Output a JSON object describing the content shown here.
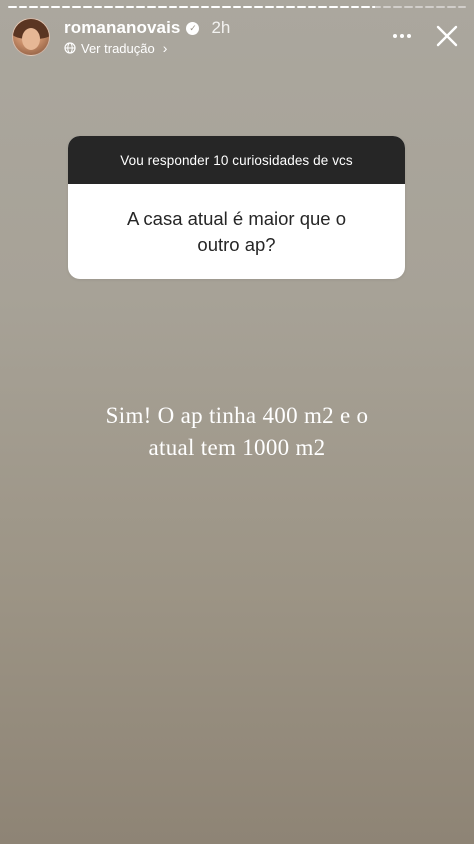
{
  "story": {
    "progress": [
      1,
      1,
      1,
      1,
      1,
      1,
      1,
      1,
      1,
      1,
      1,
      1,
      1,
      1,
      1,
      1,
      1,
      1,
      1,
      1,
      1,
      1,
      1,
      1,
      1,
      1,
      1,
      1,
      1,
      1,
      1,
      1,
      1,
      1,
      0.3,
      0,
      0,
      0,
      0,
      0,
      0,
      0,
      0
    ],
    "header": {
      "username": "romananovais",
      "time": "2h",
      "translate_label": "Ver tradução",
      "translate_chevron": "›"
    },
    "icons": {
      "avatar": "profile-photo",
      "verified": "verified-badge-icon",
      "more": "more-horizontal-icon",
      "close": "close-icon",
      "globe": "globe-icon"
    },
    "sticker": {
      "prompt": "Vou responder 10 curiosidades de vcs",
      "question": "A casa atual é maior que o outro ap?"
    },
    "answer": {
      "line1": "Sim! O ap tinha 400 m2 e o",
      "line2": "atual tem 1000 m2"
    },
    "colors": {
      "background_top": "#aba79e",
      "background_bottom": "#8e8475",
      "sticker_header": "#262626",
      "sticker_body": "#ffffff"
    }
  }
}
